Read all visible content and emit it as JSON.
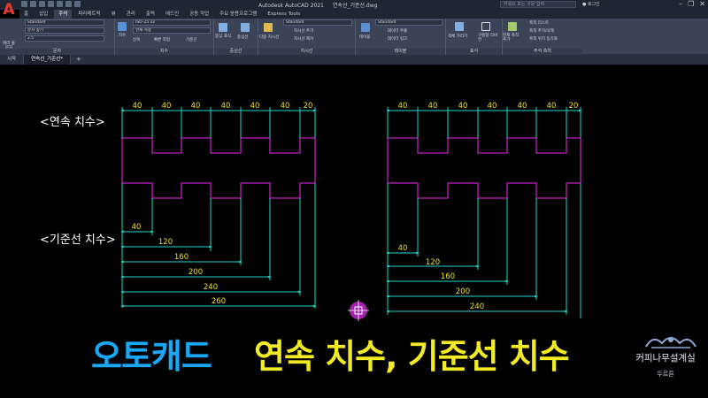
{
  "app": {
    "logo_letter": "A",
    "window_title": "Autodesk AutoCAD 2021",
    "document_name": "연속선_기준선.dwg",
    "search_placeholder": "키워드 또는 구문 입력",
    "user_label": "로그인",
    "window_controls": [
      "–",
      "❐",
      "✕"
    ]
  },
  "ribbon_tabs": [
    {
      "label": "홈"
    },
    {
      "label": "삽입"
    },
    {
      "label": "주석",
      "active": true
    },
    {
      "label": "파라메트릭"
    },
    {
      "label": "뷰"
    },
    {
      "label": "관리"
    },
    {
      "label": "출력"
    },
    {
      "label": "애드인"
    },
    {
      "label": "공동 작업"
    },
    {
      "label": "주요 응용프로그램"
    },
    {
      "label": "Express Tools"
    }
  ],
  "ribbon": {
    "text_panel": {
      "title": "문자",
      "big_button": "여러 줄\n문자",
      "style": "Standard",
      "find": "문자 찾기",
      "height": "2.5"
    },
    "dims_panel": {
      "title": "치수",
      "big_button": "치수",
      "style": "ISO-25 x2",
      "layer": "현재 사용",
      "continue": "신속",
      "baseline": "빠른 작업",
      "extra": "기준선"
    },
    "centerlines_panel": {
      "title": "중심선",
      "btn1": "중심 표식",
      "btn2": "중심선"
    },
    "leaders_panel": {
      "title": "지시선",
      "big_button": "다중 지시선",
      "style": "Standard",
      "add": "지시선 추가",
      "remove": "지시선 제거"
    },
    "tables_panel": {
      "title": "테이블",
      "big_button": "테이블",
      "style": "Standard",
      "extract": "데이터 추출",
      "link": "데이터 링크"
    },
    "markup_panel": {
      "title": "표식",
      "btn1": "객체 가리기",
      "btn2": "구름형 리비전"
    },
    "scale_panel": {
      "title": "주석 축척",
      "big_button": "현재 축척 추가",
      "scale_list": "축척 리스트",
      "add_delete": "축척 추가/삭제",
      "sync": "축척 위치 동기화"
    }
  },
  "file_tabs": [
    {
      "label": "시작"
    },
    {
      "label": "연속선_기준선*",
      "active": true
    }
  ],
  "file_tab_add": "+",
  "drawing": {
    "label_continuous": "<연속 치수>",
    "label_baseline": "<기준선 치수>",
    "left_continuous_dims": [
      "40",
      "40",
      "40",
      "40",
      "40",
      "40",
      "20"
    ],
    "right_continuous_dims": [
      "40",
      "40",
      "40",
      "40",
      "40",
      "40",
      "20"
    ],
    "left_baseline_dims": [
      "40",
      "120",
      "160",
      "200",
      "240",
      "260"
    ],
    "right_baseline_dims": [
      "40",
      "120",
      "160",
      "200",
      "240"
    ],
    "colors": {
      "shape": "#c020c0",
      "dimension": "#22d6c8",
      "dim_text": "#f0e020",
      "label": "#ffffff",
      "cursor": "#c028c8"
    }
  },
  "caption": {
    "main": "오토캐드",
    "sub": "연속 치수, 기준선 치수",
    "main_color": "#1aa8f5",
    "sub_color": "#f2ea23"
  },
  "channel": {
    "name": "커피나무설계실",
    "sub": "두르른"
  }
}
